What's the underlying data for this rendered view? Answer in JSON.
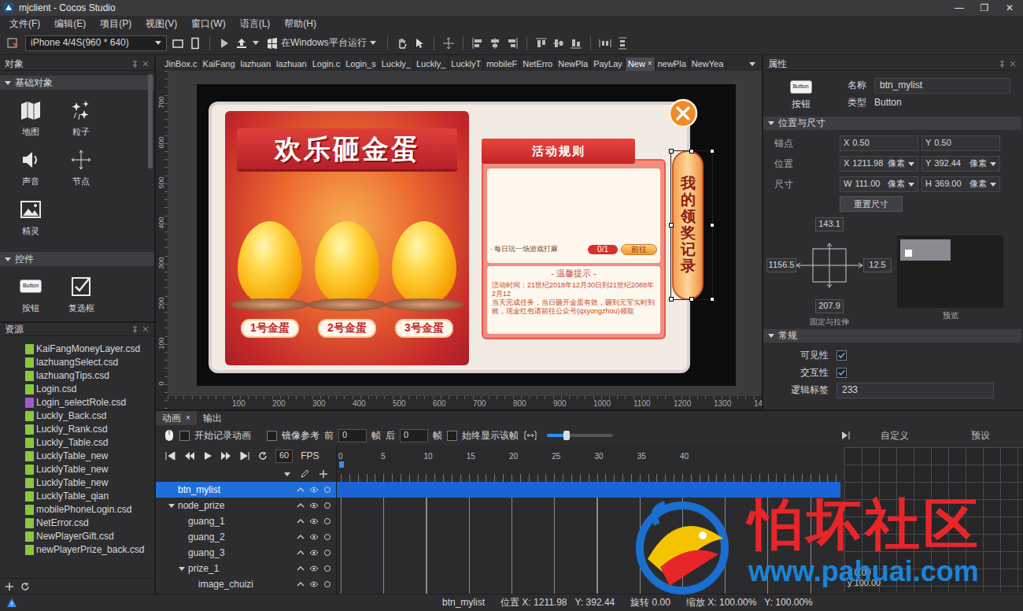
{
  "window": {
    "title": "mjclient - Cocos Studio",
    "controls": [
      "—",
      "❐",
      "✕"
    ]
  },
  "menu": [
    "文件(F)",
    "编辑(E)",
    "项目(P)",
    "视图(V)",
    "窗口(W)",
    "语言(L)",
    "帮助(H)"
  ],
  "toolbar": {
    "device": "iPhone 4/4S(960 * 640)",
    "run": "在Windows平台运行"
  },
  "objects": {
    "title": "对象",
    "sections": [
      {
        "title": "基础对象",
        "expanded": true,
        "items": [
          {
            "label": "地图",
            "kind": "map"
          },
          {
            "label": "粒子",
            "kind": "particle"
          },
          {
            "label": "声音",
            "kind": "sound"
          },
          {
            "label": "节点",
            "kind": "node"
          },
          {
            "label": "精灵",
            "kind": "sprite"
          }
        ]
      },
      {
        "title": "控件",
        "expanded": true,
        "items": [
          {
            "label": "按钮",
            "kind": "button",
            "icon_text": "Button"
          },
          {
            "label": "复选框",
            "kind": "checkbox"
          }
        ]
      }
    ]
  },
  "resources": {
    "title": "资源",
    "files": [
      {
        "name": "KaiFangMoneyLayer.csd",
        "color": "#8cc63f"
      },
      {
        "name": "lazhuangSelect.csd",
        "color": "#8cc63f"
      },
      {
        "name": "lazhuangTips.csd",
        "color": "#8cc63f"
      },
      {
        "name": "Login.csd",
        "color": "#8cc63f"
      },
      {
        "name": "Login_selectRole.csd",
        "color": "#a05acd"
      },
      {
        "name": "Luckly_Back.csd",
        "color": "#8cc63f"
      },
      {
        "name": "Luckly_Rank.csd",
        "color": "#8cc63f"
      },
      {
        "name": "Luckly_Table.csd",
        "color": "#8cc63f"
      },
      {
        "name": "LucklyTable_new",
        "color": "#8cc63f"
      },
      {
        "name": "LucklyTable_new",
        "color": "#8cc63f"
      },
      {
        "name": "LucklyTable_new",
        "color": "#8cc63f"
      },
      {
        "name": "LucklyTable_qian",
        "color": "#8cc63f"
      },
      {
        "name": "mobilePhoneLogin.csd",
        "color": "#8cc63f"
      },
      {
        "name": "NetError.csd",
        "color": "#8cc63f"
      },
      {
        "name": "NewPlayerGift.csd",
        "color": "#8cc63f"
      },
      {
        "name": "newPlayerPrize_back.csd",
        "color": "#8cc63f"
      }
    ]
  },
  "doc_tabs": [
    {
      "label": "JinBox.c",
      "selected": false
    },
    {
      "label": "KaiFang",
      "selected": false
    },
    {
      "label": "lazhuan",
      "selected": false
    },
    {
      "label": "lazhuan",
      "selected": false
    },
    {
      "label": "Login.c",
      "selected": false
    },
    {
      "label": "Login_s",
      "selected": false
    },
    {
      "label": "Luckly_",
      "selected": false
    },
    {
      "label": "Luckly_",
      "selected": false
    },
    {
      "label": "LucklyT",
      "selected": false
    },
    {
      "label": "mobileF",
      "selected": false
    },
    {
      "label": "NetErro",
      "selected": false
    },
    {
      "label": "NewPla",
      "selected": false
    },
    {
      "label": "PayLay",
      "selected": false
    },
    {
      "label": "New",
      "selected": true,
      "close": "×"
    },
    {
      "label": "newPla",
      "selected": false
    },
    {
      "label": "NewYea",
      "selected": false
    }
  ],
  "canvas": {
    "ruler_x": [
      "100",
      "200",
      "300",
      "400",
      "500",
      "600",
      "700",
      "800",
      "900",
      "1000",
      "1100",
      "1200",
      "1300",
      "14"
    ],
    "ruler_y": [
      "700",
      "600",
      "500",
      "400",
      "300",
      "200",
      "100",
      "0"
    ]
  },
  "game": {
    "title": "欢乐砸金蛋",
    "eggs": [
      "1号金蛋",
      "2号金蛋",
      "3号金蛋"
    ],
    "rules_title": "活动规则",
    "task": {
      "label": "· 每日玩一场游戏打麻",
      "progress": "0/1",
      "button": "前往"
    },
    "tips_title": "- 温馨提示 -",
    "tips": [
      "活动时间：21世纪2018年12月30日到21世纪2088年2月12",
      "当天完成任务，当日砸开金蛋有效，砸到元宝实时到账，现金红包请前往公众号(qxyongzhou)领取"
    ],
    "record_button": "我的领奖记录"
  },
  "properties": {
    "title": "属性",
    "icon_text": "Button",
    "icon_label": "按钮",
    "name_label": "名称",
    "name": "btn_mylist",
    "type_label": "类型",
    "type": "Button",
    "layout": {
      "title": "位置与尺寸",
      "expanded": true,
      "rows": [
        {
          "label": "锚点",
          "fields": [
            {
              "axis": "X",
              "value": "0.50"
            },
            {
              "axis": "Y",
              "value": "0.50"
            }
          ]
        },
        {
          "label": "位置",
          "fields": [
            {
              "axis": "X",
              "value": "1211.98",
              "unit": "像素"
            },
            {
              "axis": "Y",
              "value": "392.44",
              "unit": "像素"
            }
          ]
        },
        {
          "label": "尺寸",
          "fields": [
            {
              "axis": "W",
              "value": "111.00",
              "unit": "像素"
            },
            {
              "axis": "H",
              "value": "369.00",
              "unit": "像素"
            }
          ]
        }
      ],
      "reset": "重置尺寸",
      "margins": {
        "top": "143.1",
        "left": "1156.5",
        "right": "12.5",
        "bottom": "207.9"
      },
      "anchor_label": "固定与拉伸",
      "preview_label": "预览"
    },
    "general": {
      "title": "常规",
      "expanded": true,
      "checks": [
        {
          "label": "可见性",
          "checked": true
        },
        {
          "label": "交互性",
          "checked": true
        }
      ],
      "tag_label": "逻辑标签",
      "tag": "233"
    }
  },
  "animation": {
    "tabs": [
      {
        "label": "动画",
        "selected": true,
        "close": "×"
      },
      {
        "label": "输出",
        "selected": false
      }
    ],
    "record": {
      "label": "开始记录动画",
      "checked": false
    },
    "mirror": {
      "label": "镜像参考",
      "checked": false
    },
    "before": {
      "label": "前",
      "value": "0",
      "unit": "帧"
    },
    "after": {
      "label": "后",
      "value": "0",
      "unit": "帧"
    },
    "always": {
      "label": "始终显示该帧",
      "checked": false
    },
    "zoom": {
      "level": 0.3
    },
    "fps": "60",
    "fps_unit": "FPS",
    "frames": [
      "0",
      "5",
      "10",
      "15",
      "20",
      "25",
      "30",
      "35",
      "40"
    ],
    "tree": [
      {
        "label": "btn_mylist",
        "depth": 0,
        "kind": "leaf",
        "expanded": false,
        "selected": true
      },
      {
        "label": "node_prize",
        "depth": 0,
        "kind": "group",
        "expanded": true,
        "selected": false
      },
      {
        "label": "guang_1",
        "depth": 1,
        "kind": "leaf",
        "expanded": false,
        "selected": false
      },
      {
        "label": "guang_2",
        "depth": 1,
        "kind": "leaf",
        "expanded": false,
        "selected": false
      },
      {
        "label": "guang_3",
        "depth": 1,
        "kind": "leaf",
        "expanded": false,
        "selected": false
      },
      {
        "label": "prize_1",
        "depth": 1,
        "kind": "group",
        "expanded": true,
        "selected": false
      },
      {
        "label": "image_chuizi",
        "depth": 2,
        "kind": "leaf",
        "expanded": false,
        "selected": false
      }
    ],
    "curve": {
      "tabs": [
        "自定义",
        "预设"
      ],
      "x": "x 0.00",
      "y": "y 100.00"
    }
  },
  "status_bar": {
    "node": "btn_mylist",
    "position": "位置 X: 1211.98",
    "position_y": "Y: 392.44",
    "rotation": "旋转 0.00",
    "scale": "缩放 X: 100.00%",
    "scale_y": "Y: 100.00%"
  },
  "watermark": {
    "brand": "怕坏社区",
    "url": "www.pahuai.com"
  }
}
